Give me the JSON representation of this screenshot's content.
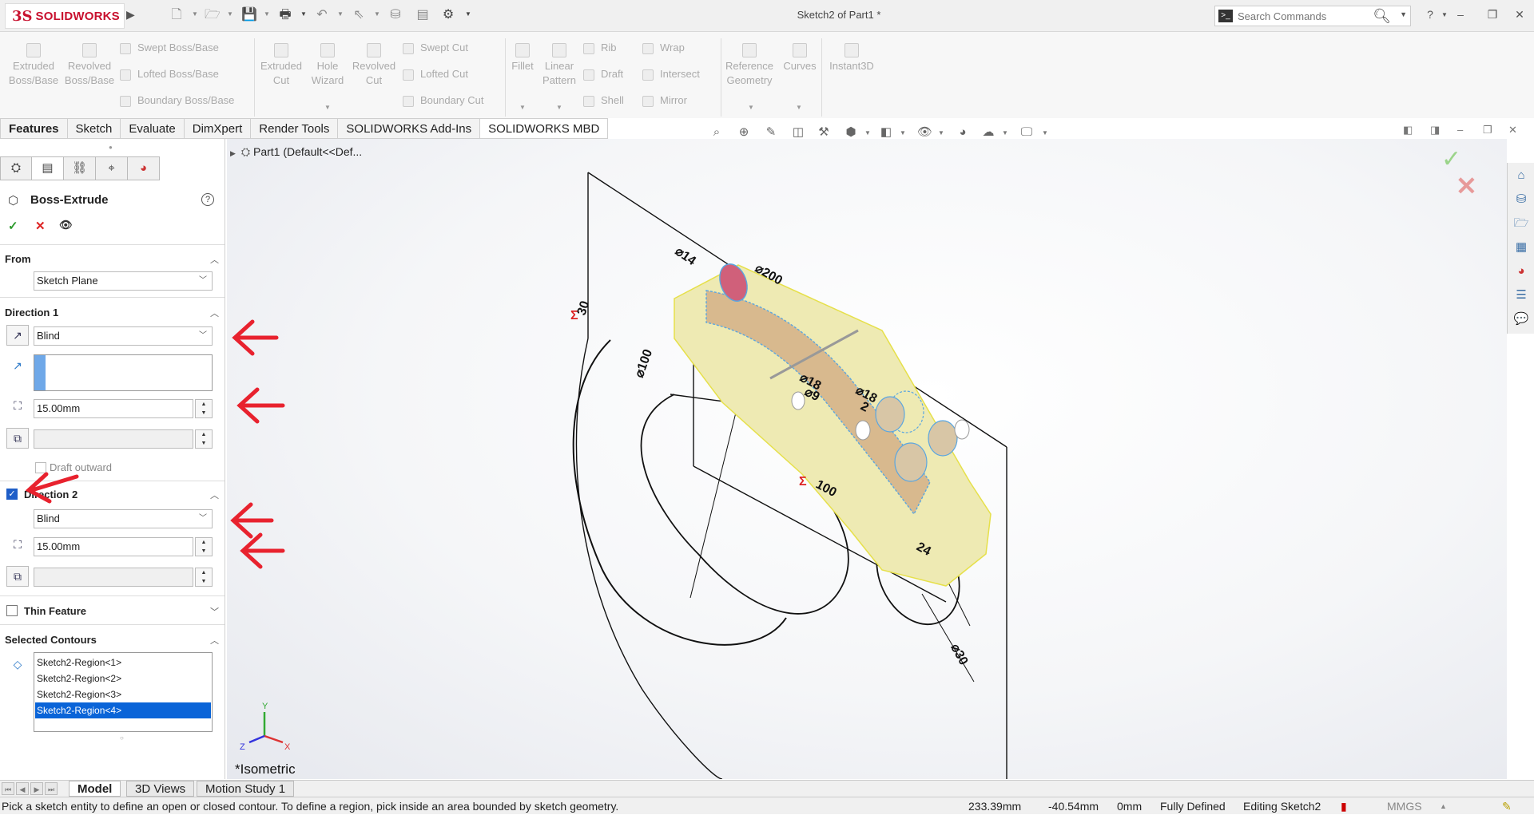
{
  "app": {
    "logo_ds": "3S",
    "logo_text": "SOLIDWORKS",
    "doc_title": "Sketch2 of Part1 *",
    "search_placeholder": "Search Commands",
    "help": "?",
    "minimize": "–",
    "restore": "❐",
    "close": "✕"
  },
  "ribbon": {
    "extruded_boss": [
      "Extruded",
      "Boss/Base"
    ],
    "revolved_boss": [
      "Revolved",
      "Boss/Base"
    ],
    "swept_boss": "Swept Boss/Base",
    "lofted_boss": "Lofted Boss/Base",
    "boundary_boss": "Boundary Boss/Base",
    "extruded_cut": [
      "Extruded",
      "Cut"
    ],
    "hole_wizard": [
      "Hole",
      "Wizard"
    ],
    "revolved_cut": [
      "Revolved",
      "Cut"
    ],
    "swept_cut": "Swept Cut",
    "lofted_cut": "Lofted Cut",
    "boundary_cut": "Boundary Cut",
    "fillet": "Fillet",
    "linear_pattern": [
      "Linear",
      "Pattern"
    ],
    "rib": "Rib",
    "draft": "Draft",
    "shell": "Shell",
    "wrap": "Wrap",
    "intersect": "Intersect",
    "mirror": "Mirror",
    "reference_geometry": [
      "Reference",
      "Geometry"
    ],
    "curves": "Curves",
    "instant3d": "Instant3D"
  },
  "tabs": [
    "Features",
    "Sketch",
    "Evaluate",
    "DimXpert",
    "Render Tools",
    "SOLIDWORKS Add-Ins",
    "SOLIDWORKS MBD"
  ],
  "pm": {
    "title": "Boss-Extrude",
    "help": "?",
    "ok": "✓",
    "cancel": "✕",
    "preview": "👁",
    "from_label": "From",
    "from_value": "Sketch Plane",
    "dir1_label": "Direction 1",
    "dir1_type": "Blind",
    "dir1_depth": "15.00mm",
    "draft_outward": "Draft outward",
    "dir2_label": "Direction 2",
    "dir2_type": "Blind",
    "dir2_depth": "15.00mm",
    "thin_feature": "Thin Feature",
    "selected_contours": "Selected Contours",
    "contours": [
      "Sketch2-Region<1>",
      "Sketch2-Region<2>",
      "Sketch2-Region<3>",
      "Sketch2-Region<4>"
    ],
    "selected_contour_index": 3
  },
  "graphics": {
    "tree_item": "Part1  (Default<<Def...",
    "view_label": "*Isometric",
    "dims": {
      "d14": "⌀14",
      "d200": "⌀200",
      "d30_left": "30",
      "d100_inner": "⌀100",
      "d18a": "⌀18",
      "d9": "⌀9",
      "d18b": "⌀18",
      "d2": "2",
      "s100": "100",
      "d24": "24",
      "d30_bottom": "⌀30",
      "sigma": "Σ"
    }
  },
  "bottom_tabs": [
    "Model",
    "3D Views",
    "Motion Study 1"
  ],
  "status": {
    "message": "Pick a sketch entity to define an open or closed contour. To define a region, pick inside an area bounded by sketch geometry.",
    "x": "233.39mm",
    "y": "-40.54mm",
    "z": "0mm",
    "state": "Fully Defined",
    "editing": "Editing Sketch2",
    "units": "MMGS"
  },
  "colors": {
    "brand_red": "#c8102e",
    "selection_blue": "#0a64d8",
    "annotation_red": "#e8222e",
    "part_yellow": "#ece8a8"
  }
}
